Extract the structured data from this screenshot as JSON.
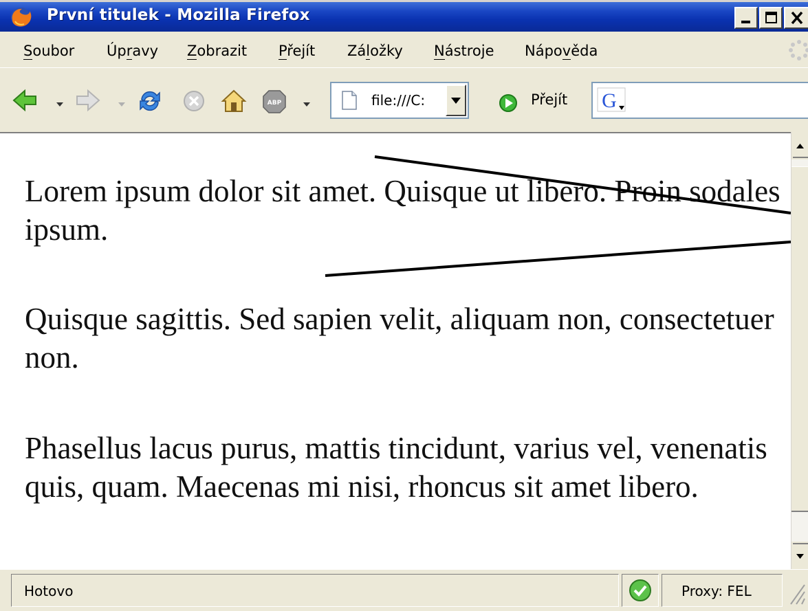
{
  "window": {
    "title": "První titulek - Mozilla Firefox",
    "title_bar_color": "#0a32b0"
  },
  "menubar": {
    "items": [
      {
        "label": "Soubor",
        "accel": "S",
        "rest": "oubor"
      },
      {
        "label": "Úpravy",
        "pre": "Úp",
        "accel": "r",
        "rest": "avy"
      },
      {
        "label": "Zobrazit",
        "accel": "Z",
        "rest": "obrazit"
      },
      {
        "label": "Přejít",
        "accel": "P",
        "rest": "řejít"
      },
      {
        "label": "Záložky",
        "pre": "Zá",
        "accel": "l",
        "rest": "ožky"
      },
      {
        "label": "Nástroje",
        "accel": "N",
        "rest": "ástroje"
      },
      {
        "label": "Nápověda",
        "pre": "Nápo",
        "accel": "v",
        "rest": "ěda"
      }
    ]
  },
  "toolbar": {
    "back_icon": "back-arrow-icon",
    "forward_icon": "forward-arrow-icon",
    "reload_icon": "reload-icon",
    "stop_icon": "stop-icon",
    "home_icon": "home-icon",
    "adblock_icon": "adblock-icon",
    "adblock_label": "ABP",
    "url": "file:///C:",
    "go_label": "Přejít",
    "search_engine_icon": "google-icon",
    "search_engine_letter": "G",
    "search_value": ""
  },
  "content": {
    "paragraphs": [
      "Lorem ipsum dolor sit amet. Quisque ut libero. Proin sodales ipsum.",
      "Quisque sagittis. Sed sapien velit, aliquam non, consectetuer non.",
      "Phasellus lacus purus, mattis tincidunt, varius vel, venenatis quis, quam. Maecenas mi nisi, rhoncus sit amet libero."
    ]
  },
  "statusbar": {
    "status": "Hotovo",
    "proxy": "Proxy: FEL",
    "secure_icon": "check-icon"
  }
}
